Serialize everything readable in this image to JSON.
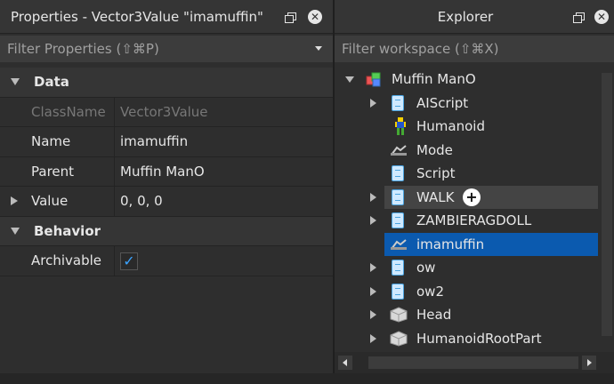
{
  "properties": {
    "title": "Properties - Vector3Value \"imamuffin\"",
    "filter_placeholder": "Filter Properties (⇧⌘P)",
    "sections": [
      {
        "label": "Data",
        "rows": [
          {
            "name": "ClassName",
            "value": "Vector3Value",
            "dimmed": true
          },
          {
            "name": "Name",
            "value": "imamuffin"
          },
          {
            "name": "Parent",
            "value": "Muffin ManO"
          },
          {
            "name": "Value",
            "value": "0, 0, 0",
            "expandable": true
          }
        ]
      },
      {
        "label": "Behavior",
        "rows": [
          {
            "name": "Archivable",
            "checked": true
          }
        ]
      }
    ]
  },
  "explorer": {
    "title": "Explorer",
    "filter_placeholder": "Filter workspace (⇧⌘X)",
    "tree": [
      {
        "label": "Muffin ManO",
        "icon": "model-icon",
        "expanded": true
      },
      {
        "label": "AIScript",
        "icon": "script-icon",
        "expandable": true
      },
      {
        "label": "Humanoid",
        "icon": "humanoid-icon"
      },
      {
        "label": "Mode",
        "icon": "value-icon"
      },
      {
        "label": "Script",
        "icon": "script-icon"
      },
      {
        "label": "WALK",
        "icon": "script-icon",
        "expandable": true,
        "hovered": true
      },
      {
        "label": "ZAMBIERAGDOLL",
        "icon": "script-icon",
        "expandable": true
      },
      {
        "label": "imamuffin",
        "icon": "value-icon",
        "selected": true
      },
      {
        "label": "ow",
        "icon": "script-icon",
        "expandable": true
      },
      {
        "label": "ow2",
        "icon": "script-icon",
        "expandable": true
      },
      {
        "label": "Head",
        "icon": "part-icon",
        "expandable": true
      },
      {
        "label": "HumanoidRootPart",
        "icon": "part-icon",
        "expandable": true
      }
    ]
  },
  "colors": {
    "selection": "#0b5aaf",
    "panel_bg": "#2e2e2e",
    "checkbox_accent": "#3ba3ff"
  }
}
